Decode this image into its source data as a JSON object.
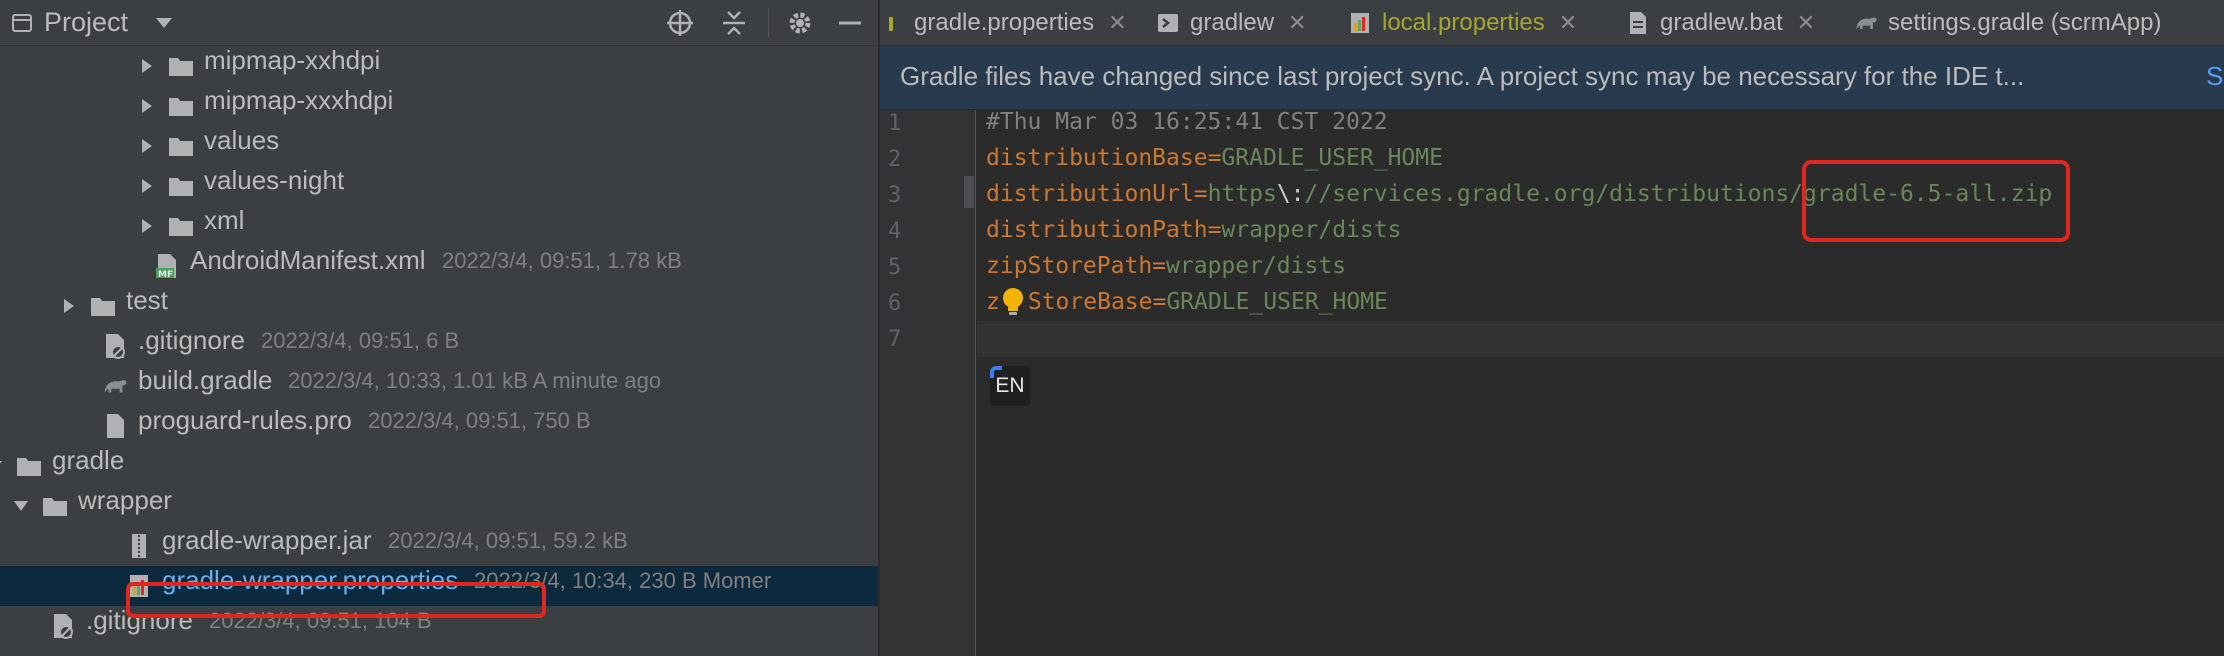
{
  "project_panel": {
    "title": "Project",
    "tree": [
      {
        "name": "mipmap-xxhdpi",
        "meta": "",
        "type": "folder",
        "expanded": false
      },
      {
        "name": "mipmap-xxxhdpi",
        "meta": "",
        "type": "folder",
        "expanded": false
      },
      {
        "name": "values",
        "meta": "",
        "type": "folder",
        "expanded": false
      },
      {
        "name": "values-night",
        "meta": "",
        "type": "folder",
        "expanded": false
      },
      {
        "name": "xml",
        "meta": "",
        "type": "folder",
        "expanded": false
      },
      {
        "name": "AndroidManifest.xml",
        "meta": "2022/3/4, 09:51, 1.78 kB",
        "type": "manifest"
      },
      {
        "name": "test",
        "meta": "",
        "type": "folder",
        "expanded": false
      },
      {
        "name": ".gitignore",
        "meta": "2022/3/4, 09:51, 6 B",
        "type": "gitignore"
      },
      {
        "name": "build.gradle",
        "meta": "2022/3/4, 10:33, 1.01 kB A minute ago",
        "type": "gradle"
      },
      {
        "name": "proguard-rules.pro",
        "meta": "2022/3/4, 09:51, 750 B",
        "type": "file"
      },
      {
        "name": "gradle",
        "meta": "",
        "type": "folder",
        "expanded": true
      },
      {
        "name": "wrapper",
        "meta": "",
        "type": "folder",
        "expanded": true
      },
      {
        "name": "gradle-wrapper.jar",
        "meta": "2022/3/4, 09:51, 59.2 kB",
        "type": "jar"
      },
      {
        "name": "gradle-wrapper.properties",
        "meta": "2022/3/4, 10:34, 230 B Momer",
        "type": "properties",
        "selected": true
      },
      {
        "name": ".gitignore",
        "meta": "2022/3/4, 09:51, 104 B",
        "type": "gitignore"
      }
    ]
  },
  "tabs": [
    {
      "label": "gradle.properties",
      "icon": "properties-icon",
      "active": false
    },
    {
      "label": "gradlew",
      "icon": "terminal-icon",
      "active": false
    },
    {
      "label": "local.properties",
      "icon": "properties-icon",
      "active": true
    },
    {
      "label": "gradlew.bat",
      "icon": "file-icon",
      "active": false
    },
    {
      "label": "settings.gradle (scrmApp)",
      "icon": "gradle-icon",
      "active": false
    }
  ],
  "tab_close_symbol": "✕",
  "banner": {
    "text": "Gradle files have changed since last project sync. A project sync may be necessary for the IDE t...",
    "link": "S"
  },
  "editor": {
    "line_numbers": [
      "1",
      "2",
      "3",
      "4",
      "5",
      "6",
      "7"
    ],
    "lines": {
      "l1": "#Thu Mar 03 16:25:41 CST 2022",
      "l2_key": "distributionBase",
      "l2_value": "GRADLE_USER_HOME",
      "l3_key": "distributionUrl",
      "l3_value_a": "https",
      "l3_escape": "\\:",
      "l3_value_b": "//services.gradle.org/distributions/gradle-6.5-all.zip",
      "l4_key": "distributionPath",
      "l4_value": "wrapper/dists",
      "l5_key": "zipStorePath",
      "l5_value": "wrapper/dists",
      "l6_key_a": "z",
      "l6_key_b": "StoreBase",
      "l6_value": "GRADLE_USER_HOME",
      "equals": "="
    },
    "ime_indicator": "EN"
  },
  "colors": {
    "panel_bg": "#3c3f41",
    "editor_bg": "#2b2b2b",
    "selection_bg": "#0d293e",
    "keyword": "#cc7832",
    "value": "#6a8759",
    "comment": "#808080",
    "annotation_red": "#e0261f"
  }
}
